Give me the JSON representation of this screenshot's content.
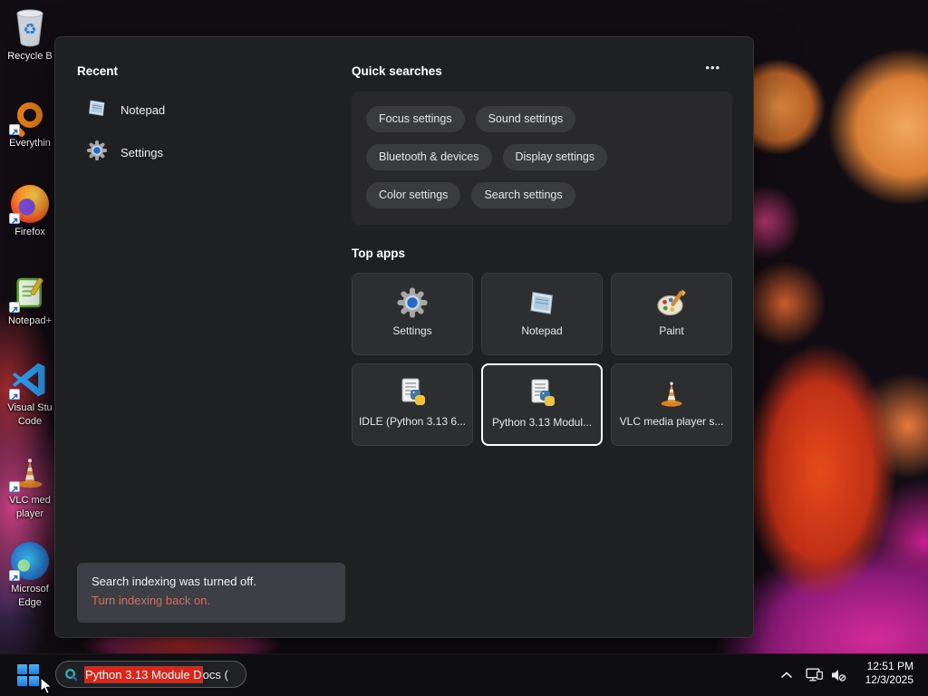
{
  "desktop": {
    "icons": [
      {
        "label": "Recycle B"
      },
      {
        "label": "Everythin"
      },
      {
        "label": "Firefox"
      },
      {
        "label": "Notepad+"
      },
      {
        "label": "Visual Stu",
        "label2": "Code"
      },
      {
        "label": "VLC med",
        "label2": "player"
      },
      {
        "label": "Microsof",
        "label2": "Edge"
      }
    ]
  },
  "panel": {
    "recent": {
      "title": "Recent",
      "items": [
        {
          "label": "Notepad"
        },
        {
          "label": "Settings"
        }
      ]
    },
    "quick": {
      "title": "Quick searches",
      "more": "•••",
      "pills": [
        "Focus settings",
        "Sound settings",
        "Bluetooth & devices",
        "Display settings",
        "Color settings",
        "Search settings"
      ]
    },
    "top_apps": {
      "title": "Top apps",
      "tiles": [
        {
          "label": "Settings"
        },
        {
          "label": "Notepad"
        },
        {
          "label": "Paint"
        },
        {
          "label": "IDLE (Python 3.13 6..."
        },
        {
          "label": "Python 3.13 Modul...",
          "selected": true
        },
        {
          "label": "VLC media player s..."
        }
      ]
    },
    "notification": {
      "message": "Search indexing was turned off.",
      "action": "Turn indexing back on."
    }
  },
  "taskbar": {
    "search": {
      "highlighted_text": "Python 3.13 Module D",
      "rest_text": "ocs ("
    },
    "tray": {
      "time": "12:51 PM",
      "date": "12/3/2025"
    }
  },
  "colors": {
    "selection_red": "#de2417",
    "notification_link": "#cf6f68",
    "accent_blue": "#2f9df4"
  }
}
